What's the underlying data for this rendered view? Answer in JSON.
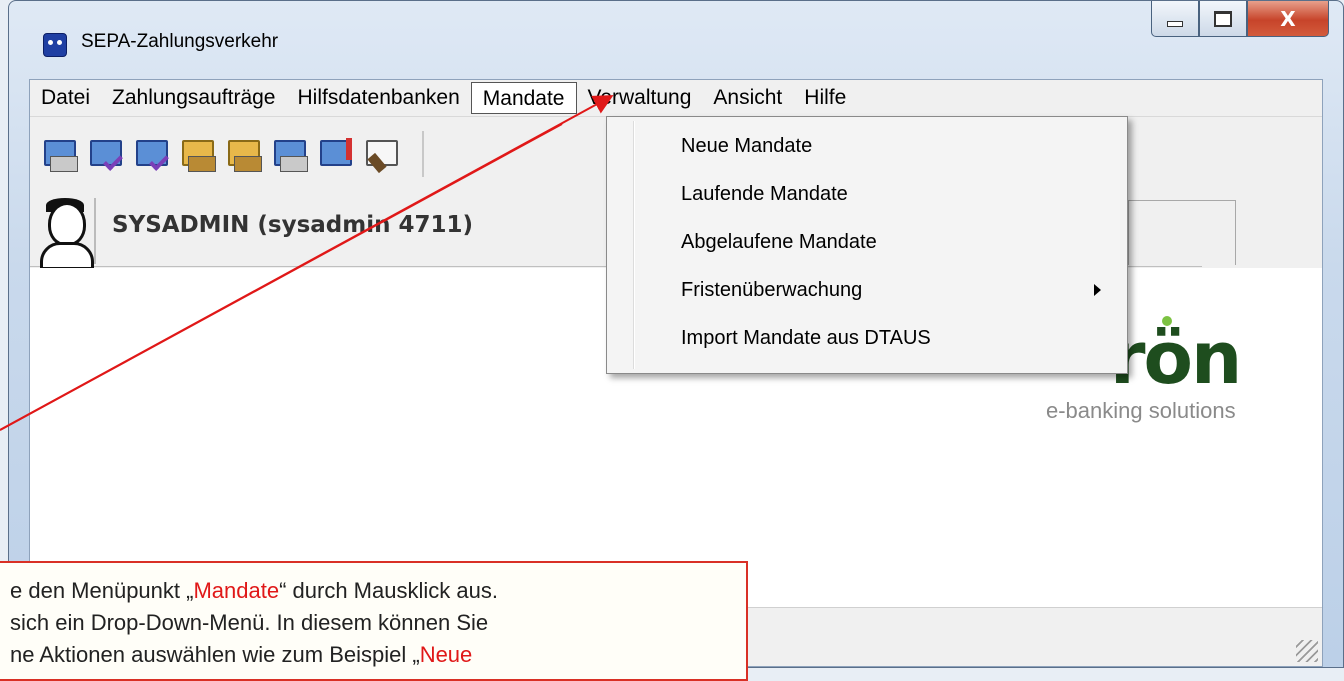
{
  "window": {
    "title": "SEPA-Zahlungsverkehr",
    "controls": {
      "minimize": "minimize",
      "maximize": "maximize",
      "close": "X"
    }
  },
  "menubar": {
    "items": [
      "Datei",
      "Zahlungsaufträge",
      "Hilfsdatenbanken",
      "Mandate",
      "Verwaltung",
      "Ansicht",
      "Hilfe"
    ],
    "active": "Mandate"
  },
  "toolbar": {
    "icons": [
      "keyboard-screen-icon",
      "checklist-icon",
      "checklist-stack-icon",
      "monitor-stack-icon",
      "folder-network-icon",
      "monitor-doc-icon",
      "monitor-flag-icon",
      "magnifier-doc-icon"
    ]
  },
  "user": {
    "label": "SYSADMIN (sysadmin 4711)"
  },
  "dropdown": {
    "items": [
      {
        "label": "Neue Mandate",
        "submenu": false
      },
      {
        "label": "Laufende Mandate",
        "submenu": false
      },
      {
        "label": "Abgelaufene Mandate",
        "submenu": false
      },
      {
        "label": "Fristenüberwachung",
        "submenu": true
      },
      {
        "label": "Import Mandate aus DTAUS",
        "submenu": false
      }
    ]
  },
  "logo": {
    "brand": "rɵn",
    "tagline": "e-banking solutions"
  },
  "callout": {
    "line1_pre": "e den Menüpunkt „",
    "line1_highlight": "Mandate",
    "line1_post": "“ durch Mausklick aus.",
    "line2": "sich ein Drop-Down-Menü. In diesem können Sie",
    "line3_pre": "ne Aktionen auswählen wie zum Beispiel „",
    "line3_highlight": "Neue",
    "highlight_color": "#e01818"
  }
}
